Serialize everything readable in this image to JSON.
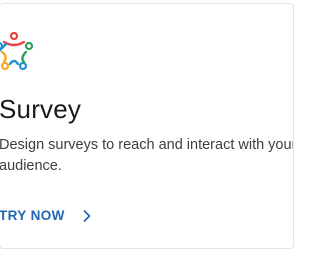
{
  "card": {
    "title": "Survey",
    "description": "Design surveys to reach and interact with your audience.",
    "cta_label": "TRY NOW",
    "logo_icon": "people-circle-icon",
    "cta_icon": "chevron-right-icon"
  },
  "colors": {
    "accent": "#1e66b4",
    "logo": [
      "#e8423f",
      "#f5a623",
      "#1f8fd8",
      "#2aa15a"
    ]
  }
}
